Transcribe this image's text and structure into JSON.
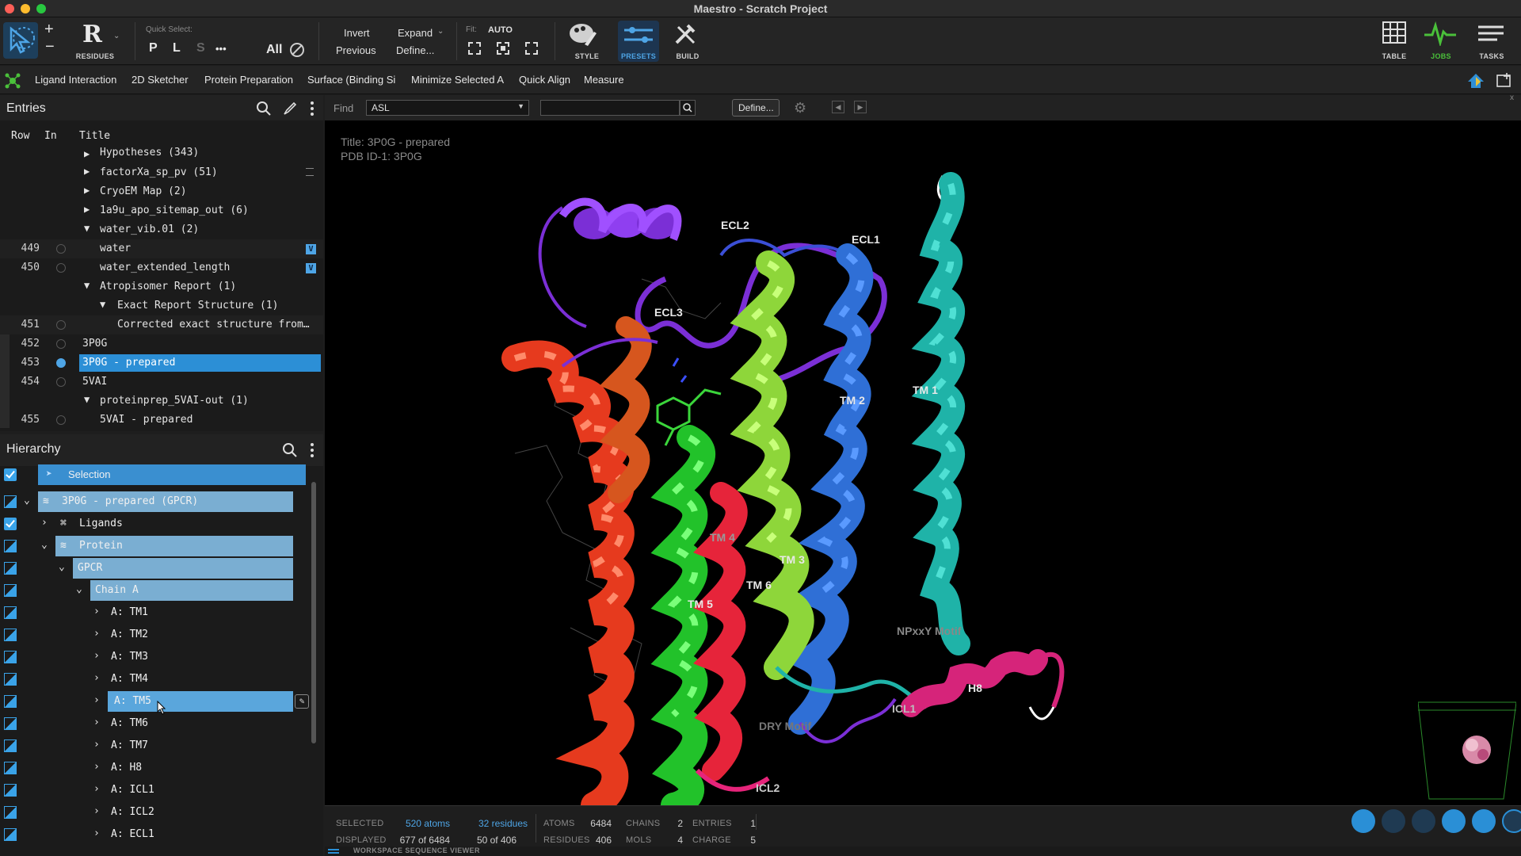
{
  "window": {
    "title": "Maestro - Scratch Project"
  },
  "toolbar": {
    "residues_label": "RESIDUES",
    "residues_letter": "R",
    "quick_select_label": "Quick Select:",
    "qs_p": "P",
    "qs_l": "L",
    "qs_s": "S",
    "qs_more": "•••",
    "qs_all": "All",
    "invert_label": "Invert",
    "previous_label": "Previous",
    "expand_label": "Expand",
    "define_label": "Define...",
    "fit_label": "Fit:",
    "fit_value": "AUTO",
    "style_label": "STYLE",
    "presets_label": "PRESETS",
    "build_label": "BUILD",
    "table_label": "TABLE",
    "jobs_label": "JOBS",
    "tasks_label": "TASKS"
  },
  "toolbar2": {
    "items": [
      "Ligand Interaction",
      "2D Sketcher",
      "Protein Preparation",
      "Surface (Binding Si",
      "Minimize Selected A",
      "Quick Align",
      "Measure"
    ]
  },
  "entries": {
    "title": "Entries",
    "col_row": "Row",
    "col_in": "In",
    "col_title": "Title",
    "rows": [
      {
        "row": "",
        "title": "Hypotheses (343)"
      },
      {
        "row": "",
        "title": "factorXa_sp_pv (51)"
      },
      {
        "row": "",
        "title": "CryoEM Map (2)"
      },
      {
        "row": "",
        "title": "1a9u_apo_sitemap_out (6)"
      },
      {
        "row": "",
        "title": "water_vib.01 (2)"
      },
      {
        "row": "449",
        "title": "water"
      },
      {
        "row": "450",
        "title": "water_extended_length"
      },
      {
        "row": "",
        "title": "Atropisomer Report (1)"
      },
      {
        "row": "",
        "title": "Exact Report Structure (1)"
      },
      {
        "row": "451",
        "title": "Corrected exact structure from…"
      },
      {
        "row": "452",
        "title": "3P0G"
      },
      {
        "row": "453",
        "title": "3P0G - prepared"
      },
      {
        "row": "454",
        "title": "5VAI"
      },
      {
        "row": "",
        "title": "proteinprep_5VAI-out (1)"
      },
      {
        "row": "455",
        "title": "5VAI - prepared"
      }
    ]
  },
  "hierarchy": {
    "title": "Hierarchy",
    "selection_label": "Selection",
    "nodes": [
      "3P0G - prepared (GPCR)",
      "Ligands",
      "Protein",
      "GPCR",
      "Chain A",
      "A: TM1",
      "A: TM2",
      "A: TM3",
      "A: TM4",
      "A: TM5",
      "A: TM6",
      "A: TM7",
      "A: H8",
      "A: ICL1",
      "A: ICL2",
      "A: ECL1"
    ]
  },
  "find": {
    "label": "Find",
    "mode": "ASL",
    "query": "",
    "define_label": "Define..."
  },
  "viewport": {
    "title_line": "Title: 3P0G - prepared",
    "pdb_line": "PDB ID-1: 3P0G",
    "labels": {
      "ecl2": "ECL2",
      "ecl1": "ECL1",
      "ecl3": "ECL3",
      "tm1": "TM 1",
      "tm2": "TM 2",
      "tm3": "TM 3",
      "tm4": "TM 4",
      "tm5": "TM 5",
      "tm6": "TM 6",
      "npxxy": "NPxxY Motif",
      "h8": "H8",
      "icl1": "ICL1",
      "icl2": "ICL2",
      "dry": "DRY Motif"
    },
    "colors": {
      "tm1": "#1fb3a8",
      "tm2": "#2f6fd6",
      "tm3": "#8ed63a",
      "tm5": "#e63a1e",
      "tm6": "#22c22a",
      "ecl2": "#7b2fd6",
      "h8": "#d6247a"
    }
  },
  "status": {
    "selected_label": "SELECTED",
    "selected_atoms": "520 atoms",
    "selected_residues": "32 residues",
    "displayed_label": "DISPLAYED",
    "displayed_atoms": "677 of 6484",
    "displayed_residues": "50 of 406",
    "atoms_label": "ATOMS",
    "atoms": "6484",
    "residues_label": "RESIDUES",
    "residues": "406",
    "chains_label": "CHAINS",
    "chains": "2",
    "mols_label": "MOLS",
    "mols": "4",
    "entries_label": "ENTRIES",
    "entries": "1",
    "charge_label": "CHARGE",
    "charge": "5",
    "bottom_label": "WORKSPACE SEQUENCE VIEWER"
  }
}
